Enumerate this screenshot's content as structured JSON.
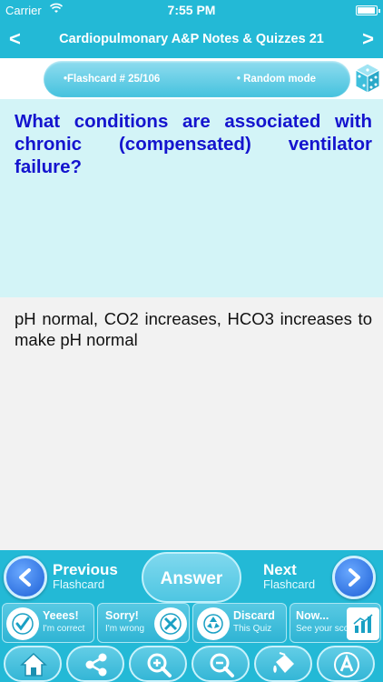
{
  "status": {
    "carrier": "Carrier",
    "time": "7:55 PM"
  },
  "nav": {
    "back_icon": "chevron-left-icon",
    "forward_icon": "chevron-right-icon",
    "title": "Cardiopulmonary A&P Notes & Quizzes 21"
  },
  "info": {
    "counter": "•Flashcard #  25/106",
    "mode": "• Random mode"
  },
  "question": "What conditions are associated with chronic (compensated) ventilator failure?",
  "answer": "pH normal, CO2 increases, HCO3 increases to make pH normal",
  "controls": {
    "previous": {
      "main": "Previous",
      "sub": "Flashcard"
    },
    "answer": "Answer",
    "next": {
      "main": "Next",
      "sub": "Flashcard"
    }
  },
  "tiles": [
    {
      "main": "Yeees!",
      "sub": "I'm correct",
      "icon": "check-icon"
    },
    {
      "main": "Sorry!",
      "sub": "I'm wrong",
      "icon": "cross-icon"
    },
    {
      "main": "Discard",
      "sub": "This Quiz",
      "icon": "recycle-icon"
    },
    {
      "main": "Now...",
      "sub": "See your score",
      "icon": "chart-icon"
    }
  ],
  "toolbar": [
    "home-icon",
    "share-icon",
    "zoom-in-icon",
    "zoom-out-icon",
    "paint-bucket-icon",
    "font-icon"
  ],
  "colors": {
    "header": "#23b9d6",
    "question_bg": "#d3f4f7",
    "question_text": "#1414ce",
    "answer_bg": "#f2f2f2"
  }
}
